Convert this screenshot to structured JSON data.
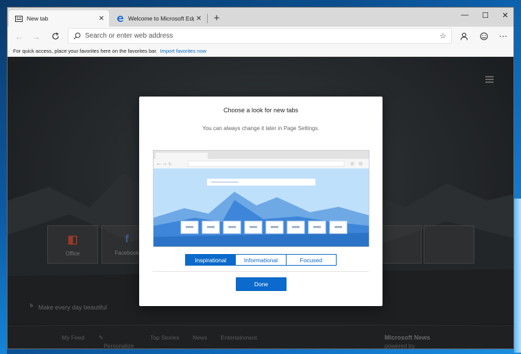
{
  "browser": {
    "tabs": [
      {
        "label": "New tab",
        "icon": "new-tab-page-icon",
        "active": true
      },
      {
        "label": "Welcome to Microsoft Edge Dev",
        "icon": "edge-logo-icon",
        "active": false
      }
    ],
    "window_controls": {
      "minimize": "—",
      "maximize": "☐",
      "close": "✕"
    },
    "address_bar": {
      "placeholder": "Search or enter web address"
    },
    "favorites_bar": {
      "message": "For quick access, place your favorites here on the favorites bar.",
      "link": "Import favorites now"
    }
  },
  "new_tab_page": {
    "tiles": [
      {
        "label": "Office",
        "icon": "office-icon"
      },
      {
        "label": "Facebook",
        "icon": "facebook-icon"
      }
    ],
    "tagline": "Make every day beautiful",
    "feed_nav": [
      "My Feed",
      "Personalize",
      "Top Stories",
      "News",
      "Entertainment"
    ],
    "powered_by": "powered by",
    "powered_brand": "Microsoft News"
  },
  "dialog": {
    "title": "Choose a look for new tabs",
    "subtitle": "You can always change it later in Page Settings.",
    "options": [
      "Inspirational",
      "Informational",
      "Focused"
    ],
    "selected": "Inspirational",
    "done_label": "Done"
  },
  "colors": {
    "accent": "#0b6acb",
    "link": "#0a6ac4"
  }
}
